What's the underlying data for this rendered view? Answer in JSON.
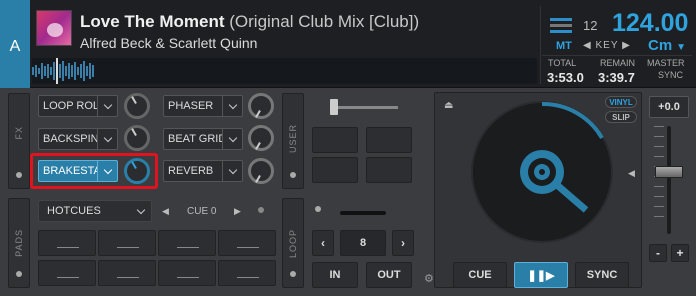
{
  "deck": {
    "letter": "A",
    "title": "Love The Moment",
    "mix": "(Original Club Mix [Club])",
    "artist": "Alfred Beck & Scarlett Quinn",
    "key_number": "12",
    "bpm": "124.00",
    "mt_label": "MT",
    "key_label": "KEY",
    "key_value": "Cm",
    "total_label": "TOTAL",
    "total_value": "3:53.0",
    "remain_label": "REMAIN",
    "remain_value": "3:39.7",
    "master_label": "MASTER",
    "sync_label": "SYNC"
  },
  "fx": {
    "side_label": "FX",
    "slots": [
      {
        "name": "LOOP ROL"
      },
      {
        "name": "BACKSPIN"
      },
      {
        "name": "BRAKESTA"
      },
      {
        "name": "PHASER"
      },
      {
        "name": "BEAT GRID"
      },
      {
        "name": "REVERB"
      }
    ]
  },
  "user": {
    "side_label": "USER"
  },
  "pads": {
    "side_label": "PADS",
    "mode": "HOTCUES",
    "page_label": "CUE 0"
  },
  "loop": {
    "side_label": "LOOP",
    "length": "8",
    "in_label": "IN",
    "out_label": "OUT"
  },
  "jog": {
    "vinyl_label": "VINYL",
    "slip_label": "SLIP"
  },
  "transport": {
    "cue_label": "CUE",
    "sync_label": "SYNC"
  },
  "pitch": {
    "value": "+0.0",
    "minus": "-",
    "plus": "+"
  },
  "colors": {
    "accent": "#2ea3de",
    "highlight": "#e0141e"
  }
}
